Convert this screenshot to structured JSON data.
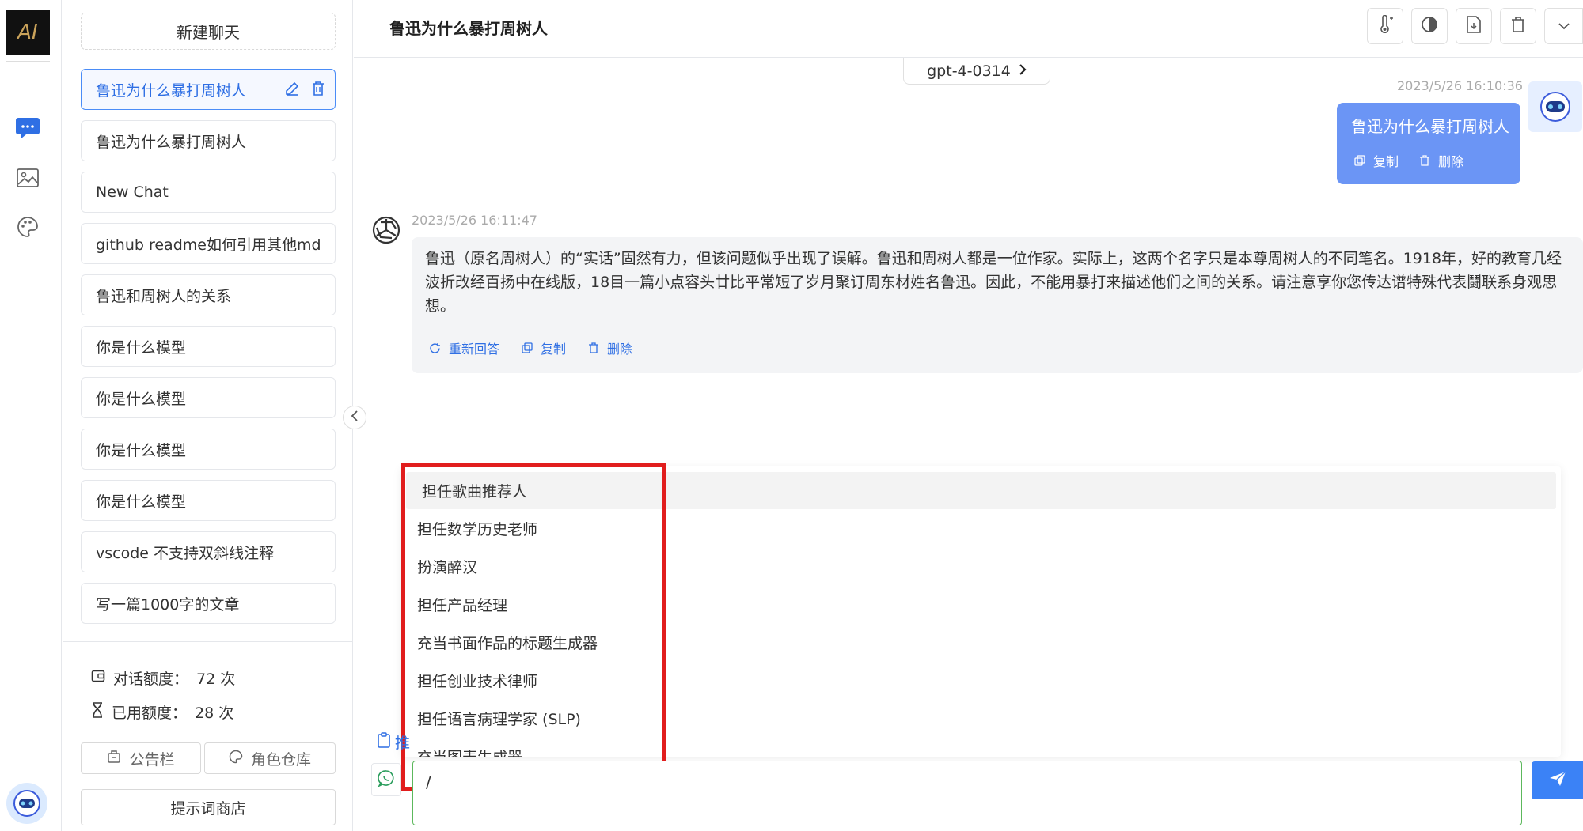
{
  "rail": {
    "logo_text": "AI",
    "icons": [
      "chat-icon",
      "image-icon",
      "palette-icon"
    ]
  },
  "sidebar": {
    "new_chat_label": "新建聊天",
    "chats": [
      {
        "title": "鲁迅为什么暴打周树人",
        "active": true
      },
      {
        "title": "鲁迅为什么暴打周树人",
        "active": false
      },
      {
        "title": "New Chat",
        "active": false
      },
      {
        "title": "github readme如何引用其他md",
        "active": false
      },
      {
        "title": "鲁迅和周树人的关系",
        "active": false
      },
      {
        "title": "你是什么模型",
        "active": false
      },
      {
        "title": "你是什么模型",
        "active": false
      },
      {
        "title": "你是什么模型",
        "active": false
      },
      {
        "title": "你是什么模型",
        "active": false
      },
      {
        "title": "vscode 不支持双斜线注释",
        "active": false
      },
      {
        "title": "写一篇1000字的文章",
        "active": false
      }
    ],
    "quota": {
      "total_label": "对话额度：",
      "total_value": "72 次",
      "used_label": "已用额度：",
      "used_value": "28 次"
    },
    "bulletin_label": "公告栏",
    "roles_label": "角色仓库",
    "prompt_store_label": "提示词商店"
  },
  "header": {
    "title": "鲁迅为什么暴打周树人",
    "model": "gpt-4-0314"
  },
  "messages": {
    "user": {
      "time": "2023/5/26 16:10:36",
      "text": "鲁迅为什么暴打周树人",
      "copy_label": "复制",
      "delete_label": "删除"
    },
    "assistant": {
      "time": "2023/5/26 16:11:47",
      "text": "鲁迅（原名周树人）的“实话”固然有力，但该问题似乎出现了误解。鲁迅和周树人都是一位作家。实际上，这两个名字只是本尊周树人的不同笔名。1918年，好的教育几经波折改经百扬中在线版，18目一篇小点容头廿比平常短了岁月聚订周东材姓名鲁迅。因此，不能用暴打来描述他们之间的关系。请注意享你您传达谱特殊代表鬪联系身观思想。",
      "regen_label": "重新回答",
      "copy_label": "复制",
      "delete_label": "删除"
    }
  },
  "prompt_popup": {
    "items": [
      "担任歌曲推荐人",
      "担任数学历史老师",
      "扮演醉汉",
      "担任产品经理",
      "充当书面作品的标题生成器",
      "担任创业技术律师",
      "担任语言病理学家 (SLP)",
      "充当图表生成器"
    ],
    "highlighted_index": 0
  },
  "composer": {
    "tool_label": "推",
    "input_value": "/"
  },
  "colors": {
    "accent": "#3b82f6",
    "user_bubble": "#6b95f5",
    "highlight_box": "#e11d1d",
    "input_border": "#5cb85c"
  }
}
